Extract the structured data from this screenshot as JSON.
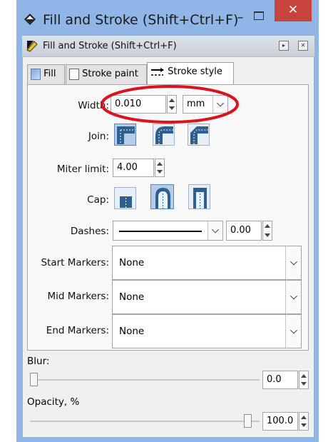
{
  "window": {
    "title": "Fill and Stroke (Shift+Ctrl+F)",
    "minimize_glyph": "–",
    "close_glyph": "✕"
  },
  "dock": {
    "title": "Fill and Stroke (Shift+Ctrl+F)",
    "button1": "▸",
    "button2": "✕"
  },
  "tabs": [
    {
      "label": "Fill"
    },
    {
      "label": "Stroke paint"
    },
    {
      "label": "Stroke style"
    }
  ],
  "stroke_style": {
    "width_label": "Width:",
    "width_value": "0.010",
    "unit_value": "mm",
    "join_label": "Join:",
    "miter_label": "Miter limit:",
    "miter_value": "4.00",
    "cap_label": "Cap:",
    "dashes_label": "Dashes:",
    "dash_offset": "0.00",
    "start_markers_label": "Start Markers:",
    "start_markers_value": "None",
    "mid_markers_label": "Mid Markers:",
    "mid_markers_value": "None",
    "end_markers_label": "End Markers:",
    "end_markers_value": "None"
  },
  "blur": {
    "label": "Blur:",
    "value": "0.0",
    "level": 0.0
  },
  "opacity": {
    "label": "Opacity, %",
    "value": "100.0",
    "level": 1.0
  },
  "colors": {
    "annotation": "#d9141e",
    "close": "#c7433b",
    "selected": "#b6cde8"
  }
}
